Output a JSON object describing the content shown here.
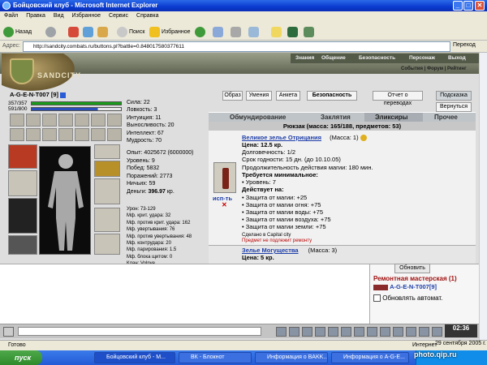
{
  "window": {
    "title": "Бойцовский клуб - Microsoft Internet Explorer"
  },
  "menu": [
    "Файл",
    "Правка",
    "Вид",
    "Избранное",
    "Сервис",
    "Справка"
  ],
  "toolbar": {
    "back": "Назад",
    "search": "Поиск",
    "favorites": "Избранное"
  },
  "address": {
    "label": "Адрес:",
    "url": "http://sandcity.combats.ru/buttons.pl?battle=0.848017580377611",
    "go": "Переход"
  },
  "game": {
    "logo": "SANDCITY",
    "nav": [
      "Знания",
      "Общение",
      "Безопасность",
      "Персонаж",
      "Выход"
    ],
    "subnav": "События | Форум | Рейтинг",
    "buttons": [
      "Образ",
      "Умения",
      "Анкета",
      "Безопасность",
      "Отчет о переводах",
      "Подсказка",
      "Вернуться"
    ],
    "character": {
      "name": "A-G-E-N-T007",
      "level": "[9]",
      "hp": "357/357",
      "mana": "591/800"
    },
    "stats": [
      "Сила: 22",
      "Ловкость: 3",
      "Интуиция: 11",
      "Выносливость: 20",
      "Интеллект: 67",
      "Мудрость: 70"
    ],
    "stats2": [
      "Опыт: 4025672 (6000000)",
      "Уровень: 9",
      "Побед: 5832",
      "Поражений: 2773",
      "Ничьих: 59"
    ],
    "money_label": "Деньги: ",
    "money_value": "396.97",
    "money_unit": " кр.",
    "stats3": [
      "Урон: 73-129",
      "Мф. крит. удара: 32",
      "Мф. против крит. удара: 162",
      "Мф. увертывания: 76",
      "Мф. против увертывания: 48",
      "Мф. контрудара: 20",
      "Мф. парирования: 1.5",
      "Мф. блока щитом: 0",
      "Клан: Volnye"
    ],
    "tabs": [
      "Обмундирование",
      "Заклятия",
      "Эликсиры",
      "Прочее"
    ],
    "pack": "Рюкзак (масса: 165/188, предметов: 53)",
    "item1": {
      "name": "Великое зелье Отрицания",
      "mass": "(Масса: 1)",
      "use": "исп-ть",
      "close": "✕",
      "lines": [
        "Цена: 12.5 кр.",
        "Долговечность: 1/2",
        "Срок годности: 15 дн. (до 10.10.05)",
        "Продолжительность действия магии: 180 мин."
      ],
      "req_title": "Требуется минимальное:",
      "req": "• Уровень: 7",
      "act_title": "Действует на:",
      "acts": [
        "• Защита от магии: +25",
        "• Защита от магии огня: +75",
        "• Защита от магии воды: +75",
        "• Защита от магии воздуха: +75",
        "• Защита от магии земли: +75"
      ],
      "made": "Сделано в Capital city",
      "norepair": "Предмет не подлежит ремонту"
    },
    "item2": {
      "name": "Зелье Могущества",
      "mass": "(Масса: 3)",
      "price": "Цена: 5 кр."
    },
    "right": {
      "refresh": "Обновить",
      "shop": "Ремонтная мастерская (1)",
      "user": "A-G-E-N-T007[9]",
      "auto": "Обновлять автомат."
    },
    "clock": "02:36"
  },
  "status": {
    "left": "Готово",
    "zone": "Интернет",
    "date": "29 сентября 2005 г."
  },
  "taskbar": {
    "start": "пуск",
    "tasks": [
      "Бойцовский клуб - М...",
      "ВК - Блокнот",
      "Информация о BAKK...",
      "Информация о A-G-E..."
    ]
  },
  "watermark": "photo.qip.ru"
}
